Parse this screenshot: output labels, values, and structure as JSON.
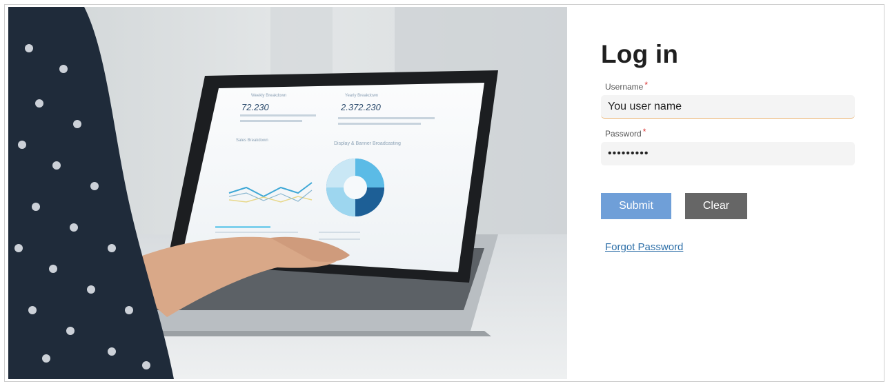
{
  "login": {
    "title": "Log in",
    "username_label": "Username",
    "username_value": "You user name",
    "password_label": "Password",
    "password_value": "•••••••••",
    "required_marker": "*",
    "submit_label": "Submit",
    "clear_label": "Clear",
    "forgot_label": "Forgot Password"
  },
  "hero_screen": {
    "stat1_label": "Weekly Breakdown",
    "stat1_value": "72.230",
    "stat2_label": "Yearly Breakdown",
    "stat2_value": "2.372.230",
    "sales_label": "Sales Breakdown",
    "display_label": "Display & Banner Broadcasting"
  },
  "colors": {
    "submit": "#6f9fd8",
    "clear": "#666666",
    "required": "#d9302f",
    "link": "#2d6fa8"
  }
}
